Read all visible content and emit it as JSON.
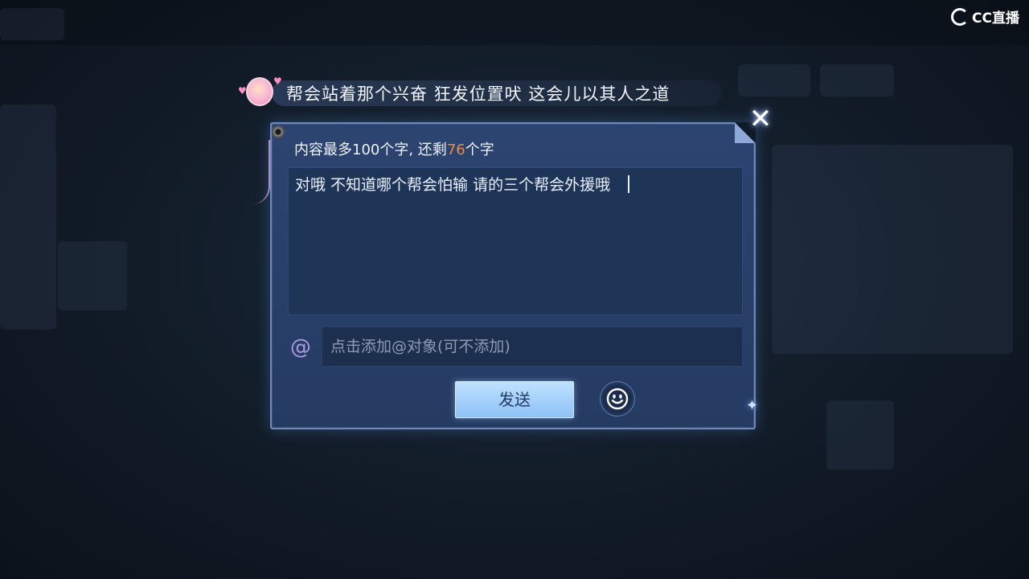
{
  "logo": {
    "text": "CC直播"
  },
  "danmaku": {
    "text": "帮会站着那个兴奋  狂发位置吠  这会儿以其人之道"
  },
  "dialog": {
    "counter_prefix": "内容最多100个字, 还剩",
    "counter_remaining": "76",
    "counter_suffix": "个字",
    "message_value": "对哦  不知道哪个帮会怕输 请的三个帮会外援哦",
    "mention_placeholder": "点击添加@对象(可不添加)",
    "send_label": "发送",
    "close_symbol": "✕"
  },
  "icons": {
    "at": "@",
    "close": "close-icon",
    "emoji": "smiley-icon"
  },
  "colors": {
    "remaining_count": "#f08a3a",
    "dialog_bg": "#2c4470",
    "send_button": "#a9d1fb"
  }
}
